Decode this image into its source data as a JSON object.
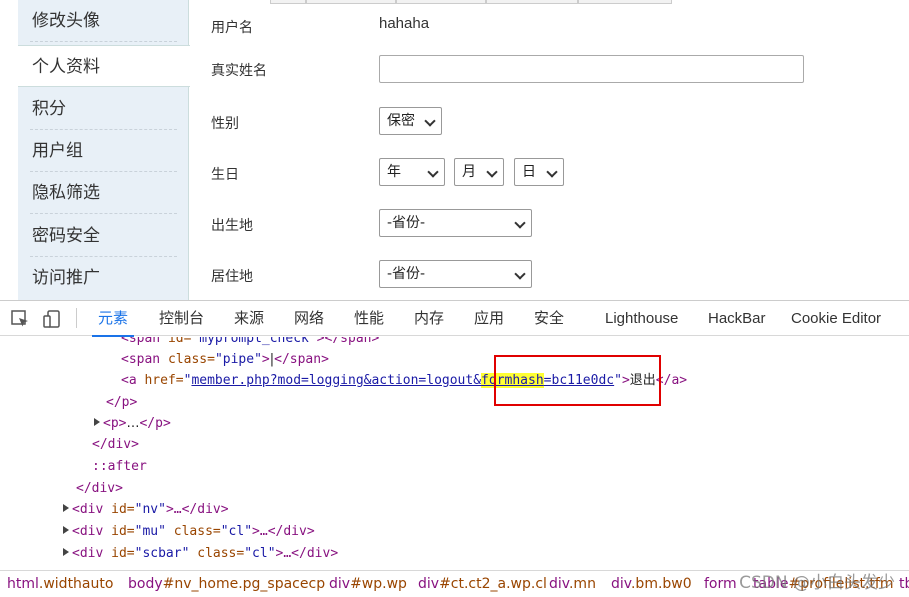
{
  "sidebar": {
    "items": [
      {
        "label": "修改头像",
        "active": false
      },
      {
        "label": "个人资料",
        "active": true
      },
      {
        "label": "积分",
        "active": false
      },
      {
        "label": "用户组",
        "active": false
      },
      {
        "label": "隐私筛选",
        "active": false
      },
      {
        "label": "密码安全",
        "active": false
      },
      {
        "label": "访问推广",
        "active": false
      }
    ]
  },
  "form": {
    "username_label": "用户名",
    "username_value": "hahaha",
    "realname_label": "真实姓名",
    "realname_value": "",
    "gender_label": "性别",
    "gender_value": "保密",
    "birthday_label": "生日",
    "birth_year": "年",
    "birth_month": "月",
    "birth_day": "日",
    "birthplace_label": "出生地",
    "birthplace_value": "-省份-",
    "residence_label": "居住地",
    "residence_value": "-省份-"
  },
  "devtools": {
    "tabs": [
      {
        "label": "元素",
        "active": true
      },
      {
        "label": "控制台",
        "active": false
      },
      {
        "label": "来源",
        "active": false
      },
      {
        "label": "网络",
        "active": false
      },
      {
        "label": "性能",
        "active": false
      },
      {
        "label": "内存",
        "active": false
      },
      {
        "label": "应用",
        "active": false
      },
      {
        "label": "安全",
        "active": false
      },
      {
        "label": "Lighthouse",
        "active": false
      },
      {
        "label": "HackBar",
        "active": false
      },
      {
        "label": "Cookie Editor",
        "active": false
      }
    ],
    "code": {
      "line0_tag_open": "<span",
      "line0_attr": " id=",
      "line0_val": "\"myprompt_check\"",
      "line0_tail": "></span>",
      "line1_tag_open": "<span",
      "line1_attr": " class=",
      "line1_val": "\"pipe\"",
      "line1_gt": ">",
      "line1_text": "|",
      "line1_close": "</span>",
      "line2_tag_open": "<a",
      "line2_attr": " href=",
      "line2_q": "\"",
      "line2_href_a": "member.php?mod=logging&action=logout&",
      "line2_href_hl": "formhash",
      "line2_href_b": "=bc11e0dc",
      "line2_q2": "\"",
      "line2_gt": ">",
      "line2_text": "退出",
      "line2_close": "</a>",
      "line3": "</p>",
      "line4_open": "<p>",
      "line4_ell": "…",
      "line4_close": "</p>",
      "line5": "</div>",
      "line6": "::after",
      "line7": "</div>",
      "line8_open": "<div",
      "line8_attr": " id=",
      "line8_val": "\"nv\"",
      "line8_tail": ">…</div>",
      "line9_open": "<div",
      "line9_attr1": " id=",
      "line9_val1": "\"mu\"",
      "line9_attr2": " class=",
      "line9_val2": "\"cl\"",
      "line9_tail": ">…</div>",
      "line10_open": "<div",
      "line10_attr1": " id=",
      "line10_val1": "\"scbar\"",
      "line10_attr2": " class=",
      "line10_val2": "\"cl\"",
      "line10_tail": ">…</div>"
    },
    "breadcrumbs": [
      {
        "tag": "html",
        "rest": ".widthauto"
      },
      {
        "tag": "body",
        "rest": "#nv_home.pg_spacecp"
      },
      {
        "tag": "div",
        "rest": "#wp.wp"
      },
      {
        "tag": "div",
        "rest": "#ct.ct2_a.wp.cl"
      },
      {
        "tag": "div",
        "rest": ".mn"
      },
      {
        "tag": "div",
        "rest": ".bm.bw0"
      },
      {
        "tag": "form",
        "rest": ""
      },
      {
        "tag": "table",
        "rest": "#profilelist.tfm"
      },
      {
        "tag": "tb",
        "rest": ""
      }
    ]
  },
  "watermark": "CSDN @小白头发少",
  "colors": {
    "highlight_box": "#e00000",
    "active_tab": "#1a73e8",
    "sidebar_bg": "#e8f0f7"
  }
}
